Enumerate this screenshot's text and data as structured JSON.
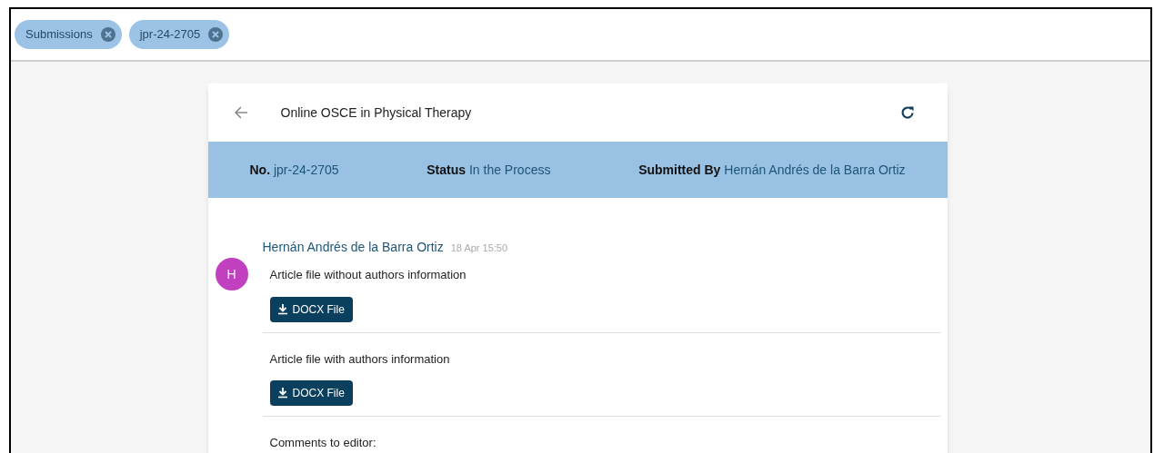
{
  "chips": [
    {
      "label": "Submissions"
    },
    {
      "label": "jpr-24-2705"
    }
  ],
  "card": {
    "title": "Online OSCE in Physical Therapy",
    "info": [
      {
        "label": "No.",
        "value": "jpr-24-2705"
      },
      {
        "label": "Status",
        "value": "In the Process"
      },
      {
        "label": "Submitted By",
        "value": "Hernán Andrés de la Barra Ortiz"
      }
    ],
    "message": {
      "avatar": "H",
      "author": "Hernán Andrés de la Barra Ortiz",
      "time": "18 Apr 15:50",
      "sections": [
        {
          "kind": "file",
          "label": "Article file without authors information",
          "button": "DOCX File"
        },
        {
          "kind": "file",
          "label": "Article file with authors information",
          "button": "DOCX File"
        },
        {
          "kind": "text",
          "label": "Comments to editor:"
        }
      ]
    }
  }
}
